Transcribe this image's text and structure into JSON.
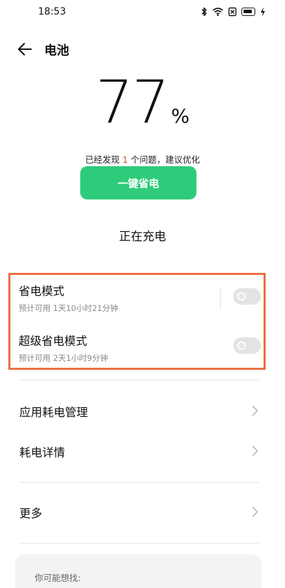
{
  "status_bar": {
    "time": "18:53",
    "icons": [
      "bluetooth-icon",
      "wifi-icon",
      "sim-off-icon",
      "battery-icon",
      "charging-bolt-icon"
    ]
  },
  "header": {
    "back_icon": "back-arrow-icon",
    "title": "电池"
  },
  "battery": {
    "percent": "77",
    "percent_sign": "%",
    "issue_prefix": "已经发现",
    "issue_count": "1",
    "issue_suffix": "个问题，建议优化",
    "optimize_button": "一键省电",
    "status": "正在充电"
  },
  "modes": [
    {
      "title": "省电模式",
      "subtitle": "预计可用 1天10小时21分钟",
      "enabled": false
    },
    {
      "title": "超级省电模式",
      "subtitle": "预计可用 2天1小时9分钟",
      "enabled": false
    }
  ],
  "menu": {
    "app_power": "应用耗电管理",
    "power_details": "耗电详情",
    "more": "更多"
  },
  "suggest": {
    "label": "你可能想找:"
  },
  "colors": {
    "accent_green": "#2ecc7a",
    "issue_red": "#e04a2f",
    "highlight_orange": "#ef6f44"
  }
}
